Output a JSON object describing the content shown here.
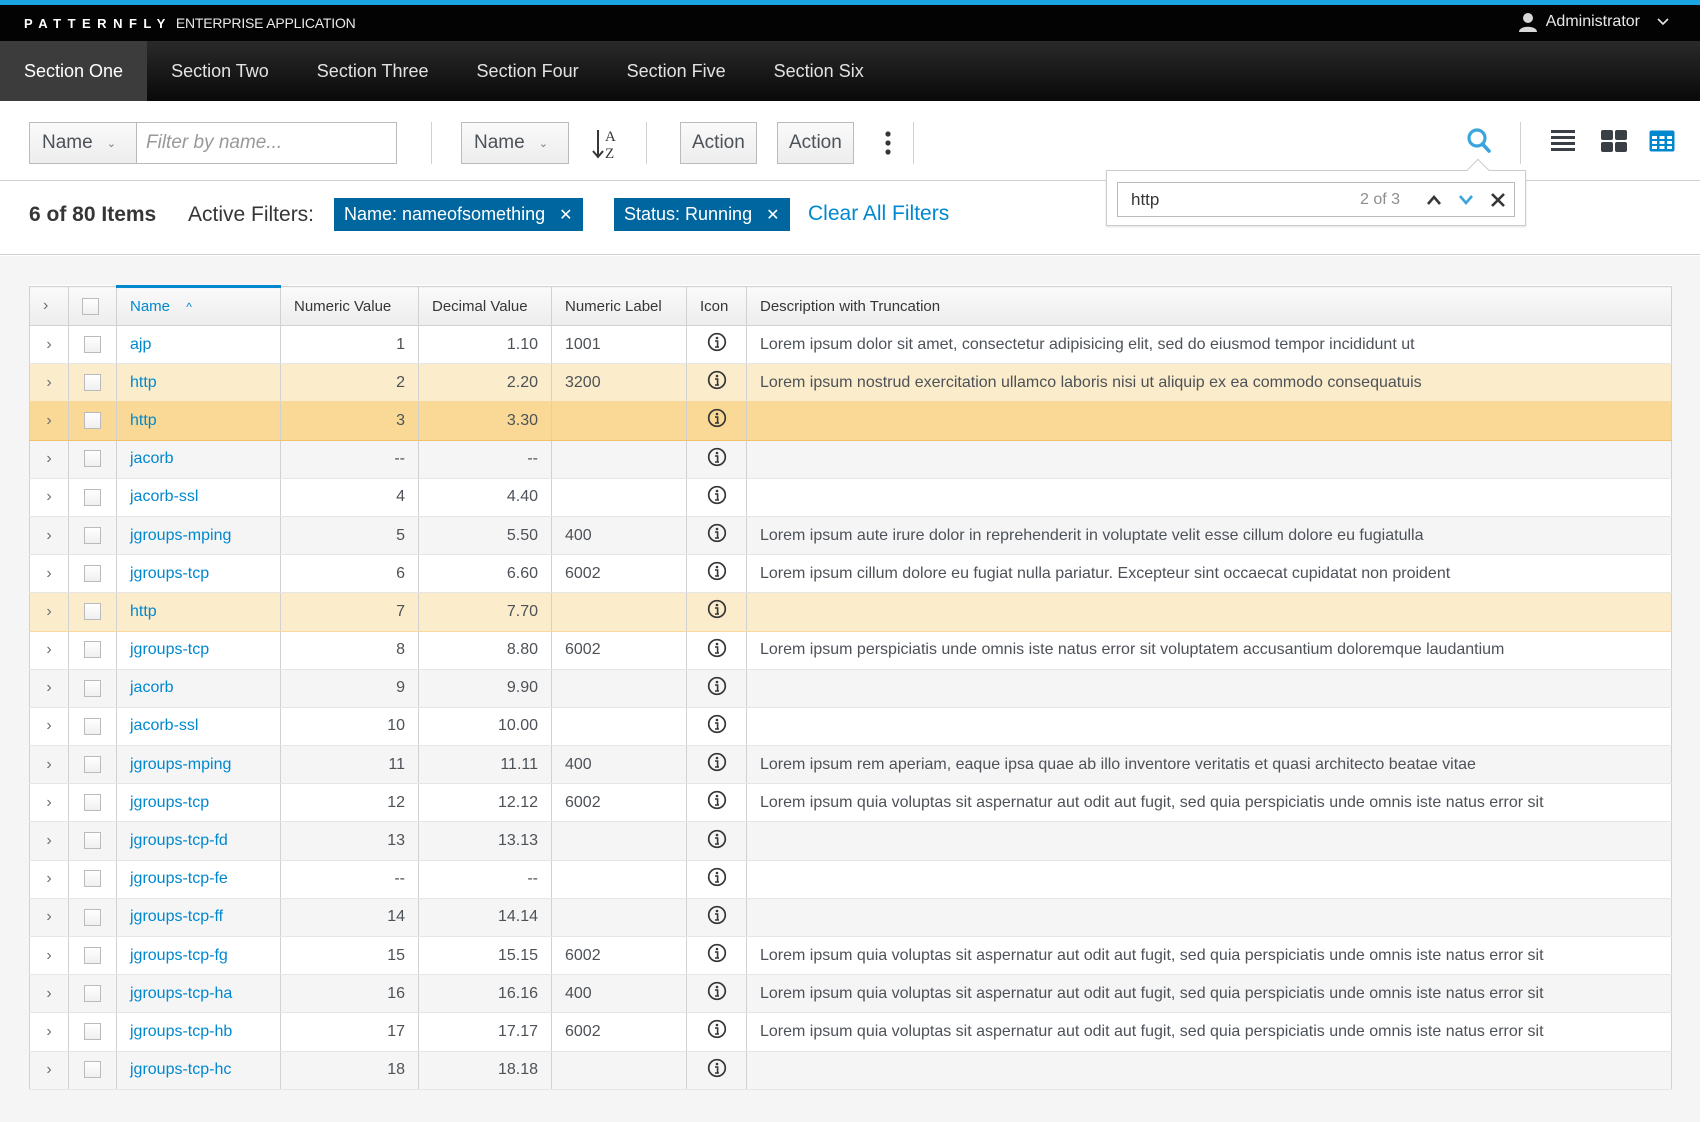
{
  "masthead": {
    "brand_logo": "PATTERNFLY",
    "brand_subtitle": "ENTERPRISE APPLICATION",
    "user_label": "Administrator"
  },
  "nav": {
    "items": [
      {
        "label": "Section One",
        "active": true
      },
      {
        "label": "Section Two"
      },
      {
        "label": "Section Three"
      },
      {
        "label": "Section Four"
      },
      {
        "label": "Section Five"
      },
      {
        "label": "Section Six"
      }
    ]
  },
  "toolbar": {
    "filter_field": "Name",
    "filter_placeholder": "Filter by name...",
    "sort_field": "Name",
    "action_1": "Action",
    "action_2": "Action",
    "views": [
      "list-view",
      "card-view",
      "table-view"
    ],
    "active_view": "table-view"
  },
  "find": {
    "query": "http",
    "count": "2 of 3"
  },
  "filters": {
    "count_label": "6 of 80 Items",
    "active_label": "Active Filters:",
    "chips": [
      {
        "label": "Name:  nameofsomething"
      },
      {
        "label": "Status:  Running"
      }
    ],
    "clear_all": "Clear All Filters"
  },
  "table": {
    "columns": [
      "Name",
      "Numeric Value",
      "Decimal Value",
      "Numeric Label",
      "Icon",
      "Description with Truncation"
    ],
    "sort_indicator": "^",
    "rows": [
      {
        "name": "ajp",
        "numeric": "1",
        "decimal": "1.10",
        "label": "1001",
        "desc": "Lorem ipsum dolor sit amet, consectetur adipisicing elit, sed do eiusmod tempor incididunt ut",
        "state": ""
      },
      {
        "name": "http",
        "numeric": "2",
        "decimal": "2.20",
        "label": "3200",
        "desc": "Lorem ipsum nostrud exercitation ullamco laboris nisi ut aliquip ex ea commodo consequatuis",
        "state": "match"
      },
      {
        "name": "http",
        "numeric": "3",
        "decimal": "3.30",
        "label": "",
        "desc": "",
        "state": "current"
      },
      {
        "name": "jacorb",
        "numeric": "--",
        "decimal": "--",
        "label": "",
        "desc": "",
        "state": "stripe"
      },
      {
        "name": "jacorb-ssl",
        "numeric": "4",
        "decimal": "4.40",
        "label": "",
        "desc": "",
        "state": ""
      },
      {
        "name": "jgroups-mping",
        "numeric": "5",
        "decimal": "5.50",
        "label": "400",
        "desc": "Lorem ipsum aute irure dolor in reprehenderit in voluptate velit esse cillum dolore eu fugiatulla",
        "state": "stripe"
      },
      {
        "name": "jgroups-tcp",
        "numeric": "6",
        "decimal": "6.60",
        "label": "6002",
        "desc": "Lorem ipsum cillum dolore eu fugiat nulla pariatur. Excepteur sint occaecat cupidatat non proident",
        "state": ""
      },
      {
        "name": "http",
        "numeric": "7",
        "decimal": "7.70",
        "label": "",
        "desc": "",
        "state": "match"
      },
      {
        "name": "jgroups-tcp",
        "numeric": "8",
        "decimal": "8.80",
        "label": "6002",
        "desc": "Lorem ipsum perspiciatis unde omnis iste natus error sit voluptatem accusantium doloremque laudantium",
        "state": ""
      },
      {
        "name": "jacorb",
        "numeric": "9",
        "decimal": "9.90",
        "label": "",
        "desc": "",
        "state": "stripe"
      },
      {
        "name": "jacorb-ssl",
        "numeric": "10",
        "decimal": "10.00",
        "label": "",
        "desc": "",
        "state": ""
      },
      {
        "name": "jgroups-mping",
        "numeric": "11",
        "decimal": "11.11",
        "label": "400",
        "desc": "Lorem ipsum rem aperiam, eaque ipsa quae ab illo inventore veritatis et quasi architecto beatae vitae",
        "state": "stripe"
      },
      {
        "name": "jgroups-tcp",
        "numeric": "12",
        "decimal": "12.12",
        "label": "6002",
        "desc": "Lorem ipsum quia voluptas sit aspernatur aut odit aut fugit, sed quia perspiciatis unde omnis iste natus error sit",
        "state": ""
      },
      {
        "name": "jgroups-tcp-fd",
        "numeric": "13",
        "decimal": "13.13",
        "label": "",
        "desc": "",
        "state": "stripe"
      },
      {
        "name": "jgroups-tcp-fe",
        "numeric": "--",
        "decimal": "--",
        "label": "",
        "desc": "",
        "state": ""
      },
      {
        "name": "jgroups-tcp-ff",
        "numeric": "14",
        "decimal": "14.14",
        "label": "",
        "desc": "",
        "state": "stripe"
      },
      {
        "name": "jgroups-tcp-fg",
        "numeric": "15",
        "decimal": "15.15",
        "label": "6002",
        "desc": "Lorem ipsum quia voluptas sit aspernatur aut odit aut fugit, sed quia perspiciatis unde omnis iste natus error sit",
        "state": ""
      },
      {
        "name": "jgroups-tcp-ha",
        "numeric": "16",
        "decimal": "16.16",
        "label": "400",
        "desc": "Lorem ipsum quia voluptas sit aspernatur aut odit aut fugit, sed quia perspiciatis unde omnis iste natus error sit",
        "state": "stripe"
      },
      {
        "name": "jgroups-tcp-hb",
        "numeric": "17",
        "decimal": "17.17",
        "label": "6002",
        "desc": "Lorem ipsum quia voluptas sit aspernatur aut odit aut fugit, sed quia perspiciatis unde omnis iste natus error sit",
        "state": ""
      },
      {
        "name": "jgroups-tcp-hc",
        "numeric": "18",
        "decimal": "18.18",
        "label": "",
        "desc": "",
        "state": "stripe"
      }
    ]
  },
  "colors": {
    "accent": "#0088ce",
    "chip": "#0066a0",
    "match_row": "#fbeccb",
    "current_match_row": "#f9d995",
    "top_strip": "#1ba4e3"
  }
}
